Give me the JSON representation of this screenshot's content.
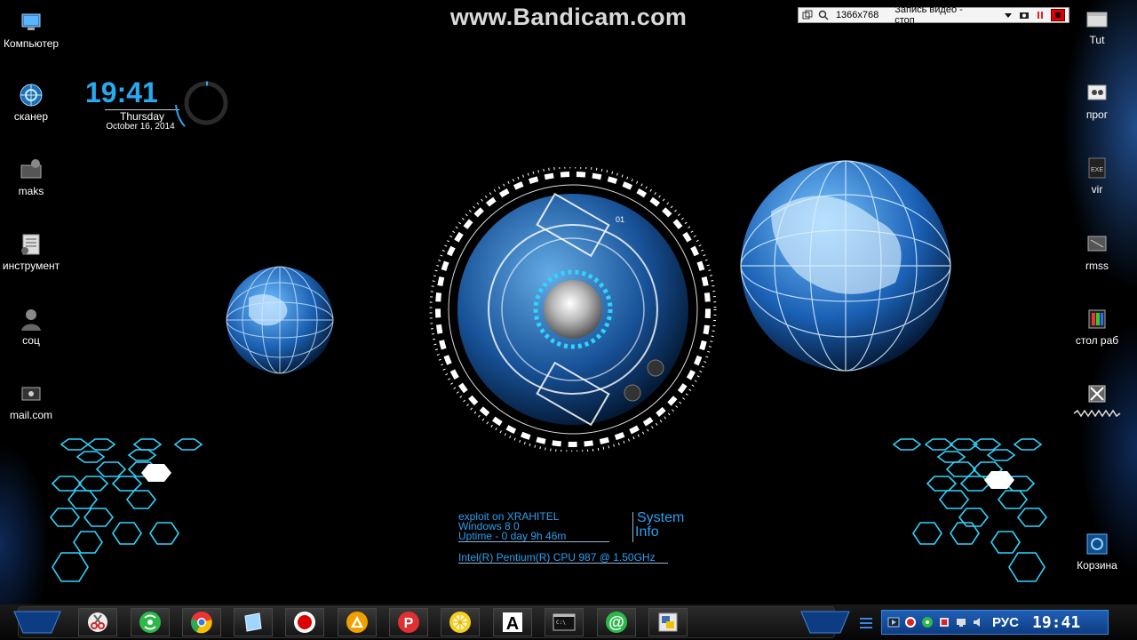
{
  "watermark": "www.Bandicam.com",
  "recorder": {
    "resolution": "1366x768",
    "status": "Запись видео - стоп"
  },
  "desktop_left": [
    {
      "label": "Компьютер",
      "icon": "computer-icon"
    },
    {
      "label": "сканер",
      "icon": "scanner-icon"
    },
    {
      "label": "maks",
      "icon": "folder-icon"
    },
    {
      "label": "инструмент",
      "icon": "tools-icon"
    },
    {
      "label": "соц",
      "icon": "user-icon"
    },
    {
      "label": "mail.com",
      "icon": "mail-icon"
    }
  ],
  "desktop_right": [
    {
      "label": "Tut",
      "icon": "folder-icon"
    },
    {
      "label": "прог",
      "icon": "programs-icon"
    },
    {
      "label": "vir",
      "icon": "exe-icon"
    },
    {
      "label": "rmss",
      "icon": "folder-icon"
    },
    {
      "label": "стол раб",
      "icon": "desktop-icon"
    },
    {
      "label": "Корзина",
      "icon": "recycle-bin-icon"
    }
  ],
  "clock": {
    "time": "19:41",
    "day": "Thursday",
    "date": "October 16, 2014"
  },
  "hud": {
    "badge": "01"
  },
  "sysinfo": {
    "title_line1": "System",
    "title_line2": "Info",
    "host": "exploit on XRAHITEL",
    "os": "Windows 8 0",
    "uptime": "Uptime - 0 day 9h 46m",
    "cpu": "Intel(R) Pentium(R) CPU 987 @ 1.50GHz"
  },
  "taskbar": {
    "dock_items": [
      {
        "name": "scissors-app",
        "icon": "scissors-icon"
      },
      {
        "name": "network-app",
        "icon": "wifi-icon"
      },
      {
        "name": "chrome-app",
        "icon": "chrome-icon"
      },
      {
        "name": "explorer-app",
        "icon": "window-icon"
      },
      {
        "name": "record-app",
        "icon": "record-icon"
      },
      {
        "name": "media-app",
        "icon": "triangle-icon"
      },
      {
        "name": "pinterest-app",
        "icon": "p-icon"
      },
      {
        "name": "lemon-app",
        "icon": "lemon-icon"
      },
      {
        "name": "font-app",
        "icon": "letter-a-icon"
      },
      {
        "name": "cmd-app",
        "icon": "terminal-icon"
      },
      {
        "name": "mail-app",
        "icon": "at-icon"
      },
      {
        "name": "python-app",
        "icon": "python-icon"
      }
    ],
    "language": "РУС",
    "time": "19:41"
  },
  "colors": {
    "accent": "#29a9ef",
    "hex_cyan": "#2fd4ff",
    "tray_blue": "#1f5fb5",
    "record_red": "#dd0000"
  }
}
